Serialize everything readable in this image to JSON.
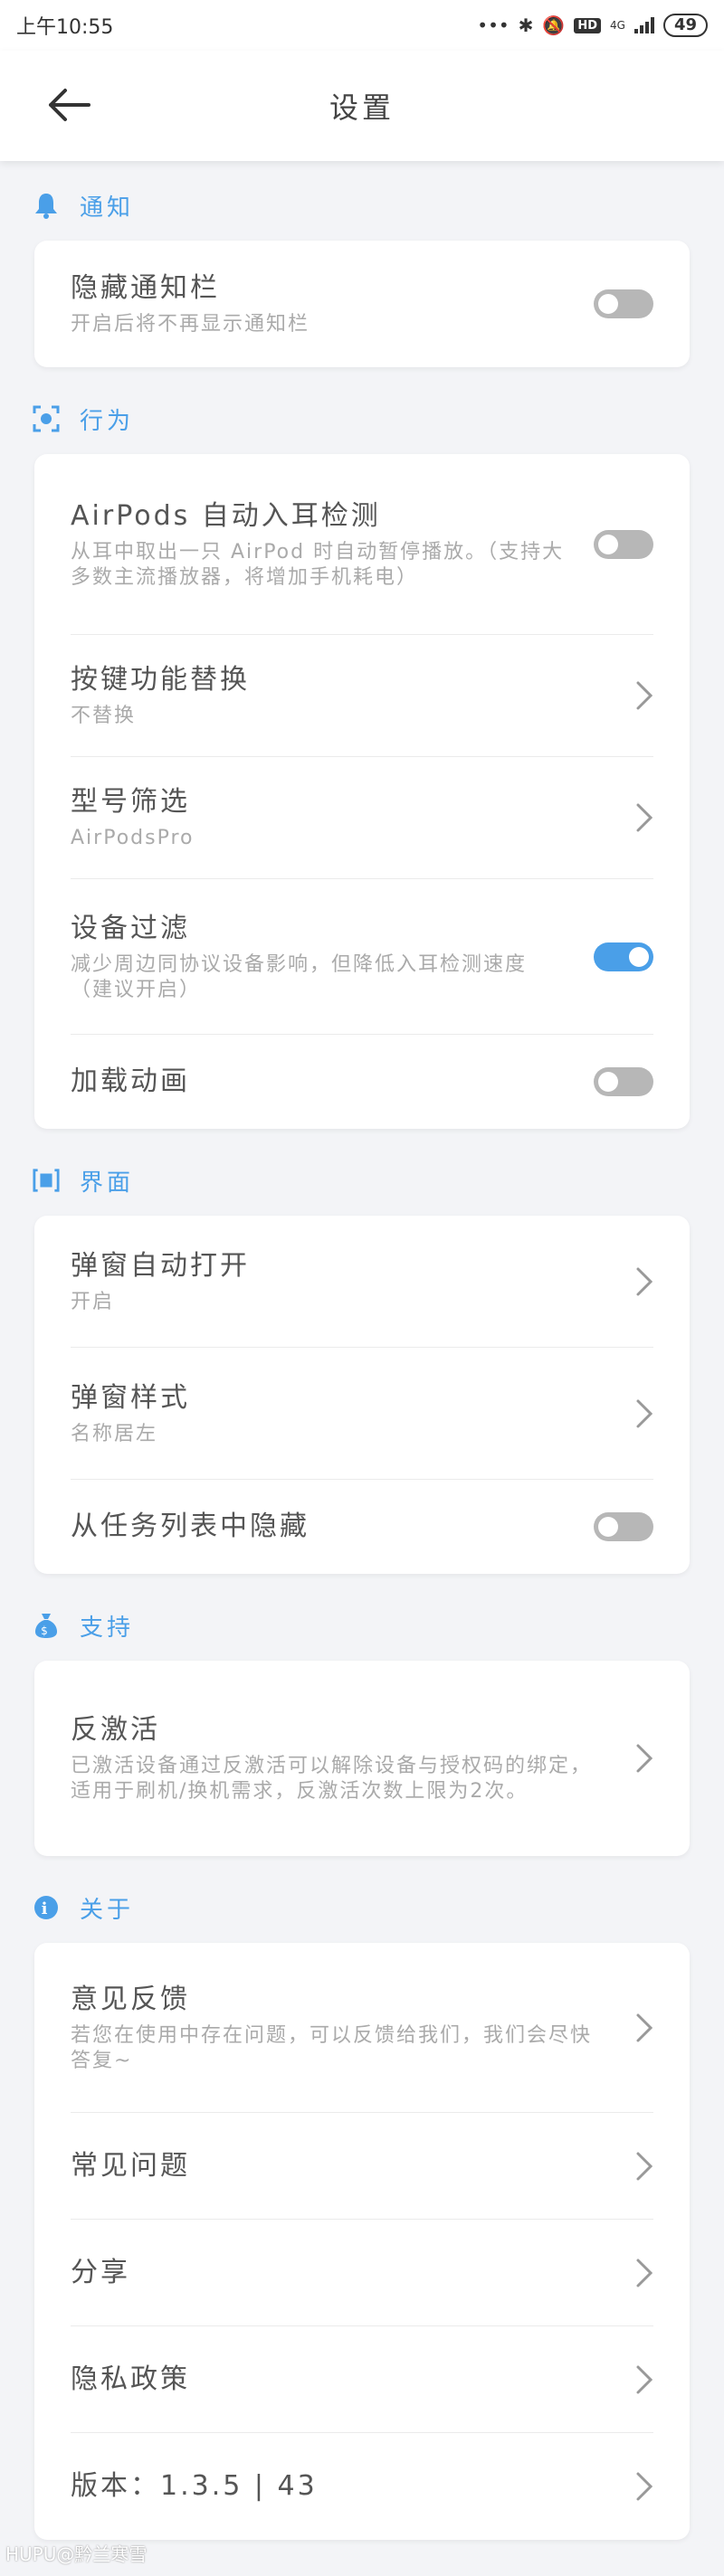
{
  "status_bar": {
    "time": "上午10:55",
    "hd": "HD",
    "network": "4G",
    "battery": "49"
  },
  "header": {
    "title": "设置"
  },
  "sections": {
    "notify": {
      "title": "通知",
      "items": [
        {
          "title": "隐藏通知栏",
          "subtitle": "开启后将不再显示通知栏",
          "toggle": false
        }
      ]
    },
    "behavior": {
      "title": "行为",
      "items": [
        {
          "title": "AirPods 自动入耳检测",
          "subtitle": "从耳中取出一只 AirPod 时自动暂停播放。（支持大多数主流播放器，将增加手机耗电）",
          "toggle": false
        },
        {
          "title": "按键功能替换",
          "subtitle": "不替换"
        },
        {
          "title": "型号筛选",
          "subtitle": "AirPodsPro"
        },
        {
          "title": "设备过滤",
          "subtitle": "减少周边同协议设备影响，但降低入耳检测速度（建议开启）",
          "toggle": true
        },
        {
          "title": "加载动画",
          "toggle": false
        }
      ]
    },
    "interface": {
      "title": "界面",
      "items": [
        {
          "title": "弹窗自动打开",
          "subtitle": "开启"
        },
        {
          "title": "弹窗样式",
          "subtitle": "名称居左"
        },
        {
          "title": "从任务列表中隐藏",
          "toggle": false
        }
      ]
    },
    "support": {
      "title": "支持",
      "items": [
        {
          "title": "反激活",
          "subtitle": "已激活设备通过反激活可以解除设备与授权码的绑定，适用于刷机/换机需求，反激活次数上限为2次。"
        }
      ]
    },
    "about": {
      "title": "关于",
      "items": [
        {
          "title": "意见反馈",
          "subtitle": "若您在使用中存在问题，可以反馈给我们，我们会尽快答复~"
        },
        {
          "title": "常见问题"
        },
        {
          "title": "分享"
        },
        {
          "title": "隐私政策"
        },
        {
          "title": "版本：1.3.5 | 43"
        }
      ]
    }
  },
  "watermark": "HUPU@黔兰寒雪",
  "colors": {
    "accent": "#4a9fe8",
    "toggle_off": "#b7b7b7"
  }
}
